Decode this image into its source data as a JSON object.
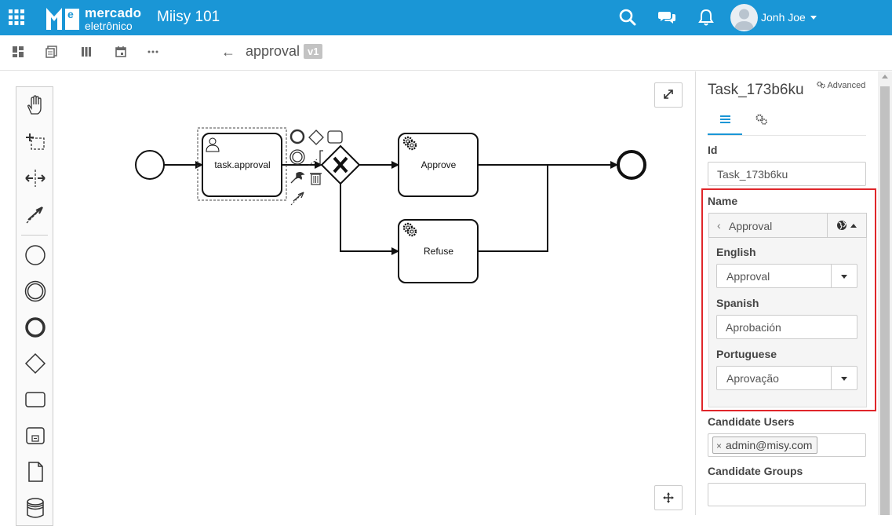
{
  "header": {
    "brand_line1": "mercado",
    "brand_line2": "eletrônico",
    "app_title": "Miisy 101",
    "user_name": "Jonh Joe",
    "icons": [
      "apps-grid-icon",
      "search-icon",
      "chat-icon",
      "bell-icon",
      "avatar"
    ]
  },
  "toolbar": {
    "process_title": "approval",
    "version": "v1",
    "back_icon": "←"
  },
  "diagram": {
    "elements": [
      {
        "type": "start-event",
        "label": ""
      },
      {
        "type": "user-task",
        "label": "task.approval",
        "selected": true
      },
      {
        "type": "exclusive-gateway",
        "label": ""
      },
      {
        "type": "service-task",
        "label": "Approve"
      },
      {
        "type": "service-task",
        "label": "Refuse"
      },
      {
        "type": "end-event",
        "label": ""
      }
    ],
    "palette_tools": [
      "hand-tool",
      "lasso-tool",
      "space-tool",
      "connect-tool",
      "start-event",
      "intermediate-event",
      "end-event",
      "gateway",
      "task",
      "subprocess",
      "data-object",
      "data-store"
    ]
  },
  "panel": {
    "title": "Task_173b6ku",
    "advanced_label": "Advanced",
    "id_label": "Id",
    "id_value": "Task_173b6ku",
    "name_label": "Name",
    "name_value": "Approval",
    "translations": [
      {
        "language": "English",
        "value": "Approval",
        "has_dropdown": true
      },
      {
        "language": "Spanish",
        "value": "Aprobación",
        "has_dropdown": false
      },
      {
        "language": "Portuguese",
        "value": "Aprovação",
        "has_dropdown": true
      }
    ],
    "candidate_users_label": "Candidate Users",
    "candidate_users": [
      "admin@misy.com"
    ],
    "candidate_groups_label": "Candidate Groups",
    "candidate_groups_value": ""
  },
  "colors": {
    "header_bg": "#1a96d6",
    "highlight_border": "#e0262a",
    "tab_active": "#1a96d6"
  }
}
